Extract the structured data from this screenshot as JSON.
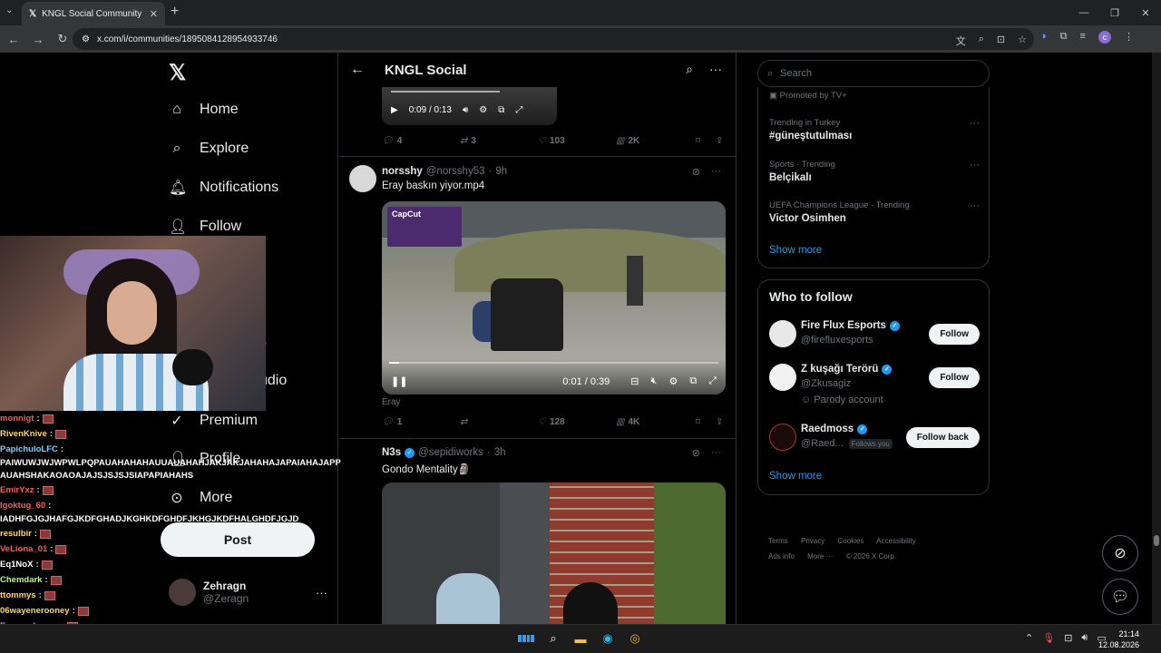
{
  "browser": {
    "tab_title": "KNGL Social Community / X",
    "url": "x.com/i/communities/1895084128954933746",
    "tab_icon": "x-icon"
  },
  "nav": {
    "items": [
      {
        "label": "Home",
        "icon": "home-icon"
      },
      {
        "label": "Explore",
        "icon": "search-icon"
      },
      {
        "label": "Notifications",
        "icon": "bell-icon"
      },
      {
        "label": "Follow",
        "icon": "person-add-icon"
      },
      {
        "label": "Premium",
        "icon": "premium-icon"
      },
      {
        "label": "More",
        "icon": "more-circle-icon"
      }
    ],
    "partial_labels": [
      "s",
      "udio",
      "Profile"
    ],
    "post_label": "Post",
    "account": {
      "name": "Zehragn",
      "handle": "@Zeragn"
    }
  },
  "chat": [
    {
      "user": "monnigt",
      "color": "#ff5a5a",
      "msg": ""
    },
    {
      "user": "RivenKnive",
      "color": "#ffd866",
      "msg": ""
    },
    {
      "user": "PapichuloLFC",
      "color": "#7fd0ff",
      "msg": "PAIWUWJWJWPWLPQPAUAHAHAHAUUAUAHAHJAKJAKJAHAHAJAPAIAHAJAPP AUAHSHAKAOAOAJAJSJSJSJSIAPAPIAHAHS"
    },
    {
      "user": "EmirYxz",
      "color": "#ff5a5a",
      "msg": ""
    },
    {
      "user": "Igoktug_60",
      "color": "#ff5a5a",
      "msg": "IADHFGJGJHAFGJKDFGHADJKGHKDFGHDFJKHGJKDFHALGHDFJGJD"
    },
    {
      "user": "resulbir",
      "color": "#ffd866",
      "msg": ""
    },
    {
      "user": "VeLiona_01",
      "color": "#ff5a5a",
      "msg": ""
    },
    {
      "user": "Eq1NoX",
      "color": "#ffffff",
      "msg": ""
    },
    {
      "user": "Chemdark",
      "color": "#b6ff6b",
      "msg": ""
    },
    {
      "user": "ttommys",
      "color": "#ffd866",
      "msg": ""
    },
    {
      "user": "06wayenerooney",
      "color": "#ffd866",
      "msg": ""
    },
    {
      "user": "Eymen_bucan",
      "color": "#c58aff",
      "msg": ""
    }
  ],
  "main": {
    "title": "KNGL Social",
    "top_video": {
      "time": "0:09 / 0:13"
    },
    "top_actions": {
      "replies": "4",
      "reposts": "3",
      "likes": "103",
      "views": "2K"
    },
    "tweet1": {
      "name": "norsshy",
      "handle": "@norsshy53",
      "time": "9h",
      "text": "Eray baskın yiyor.mp4",
      "watermark": "CapCut",
      "video_time": "0:01 / 0:39",
      "progress": 0.03,
      "caption": "Eray",
      "actions": {
        "replies": "1",
        "reposts": "",
        "likes": "128",
        "views": "4K"
      }
    },
    "tweet2": {
      "name": "N3s",
      "handle": "@sepidiworks",
      "time": "3h",
      "text": "Gondo Mentality🗿"
    }
  },
  "right": {
    "search_placeholder": "Search",
    "promoted": "Promoted by TV+",
    "trends": [
      {
        "category": "Trending in Turkey",
        "name": "#güneştutulması"
      },
      {
        "category": "Sports · Trending",
        "name": "Belçikalı"
      },
      {
        "category": "UEFA Champions League · Trending",
        "name": "Victor Osimhen"
      }
    ],
    "show_more": "Show more",
    "who_to_follow": {
      "title": "Who to follow",
      "items": [
        {
          "name": "Fire Flux Esports",
          "handle": "@firefluxesports",
          "button": "Follow",
          "extra": "",
          "follows_you": ""
        },
        {
          "name": "Z kuşağı Terörü",
          "handle": "@Zkusagiz",
          "button": "Follow",
          "extra": "Parody account",
          "follows_you": ""
        },
        {
          "name": "Raedmoss",
          "handle": "@Raed...",
          "button": "Follow back",
          "extra": "",
          "follows_you": "Follows you"
        }
      ],
      "show_more": "Show more"
    },
    "footer": {
      "links": [
        "Terms",
        "Privacy",
        "Cookies",
        "Accessibility",
        "Ads info",
        "More ···"
      ],
      "copyright": "© 2026 X Corp."
    }
  },
  "taskbar": {
    "time": "21:14",
    "date": "12.08.2026"
  }
}
